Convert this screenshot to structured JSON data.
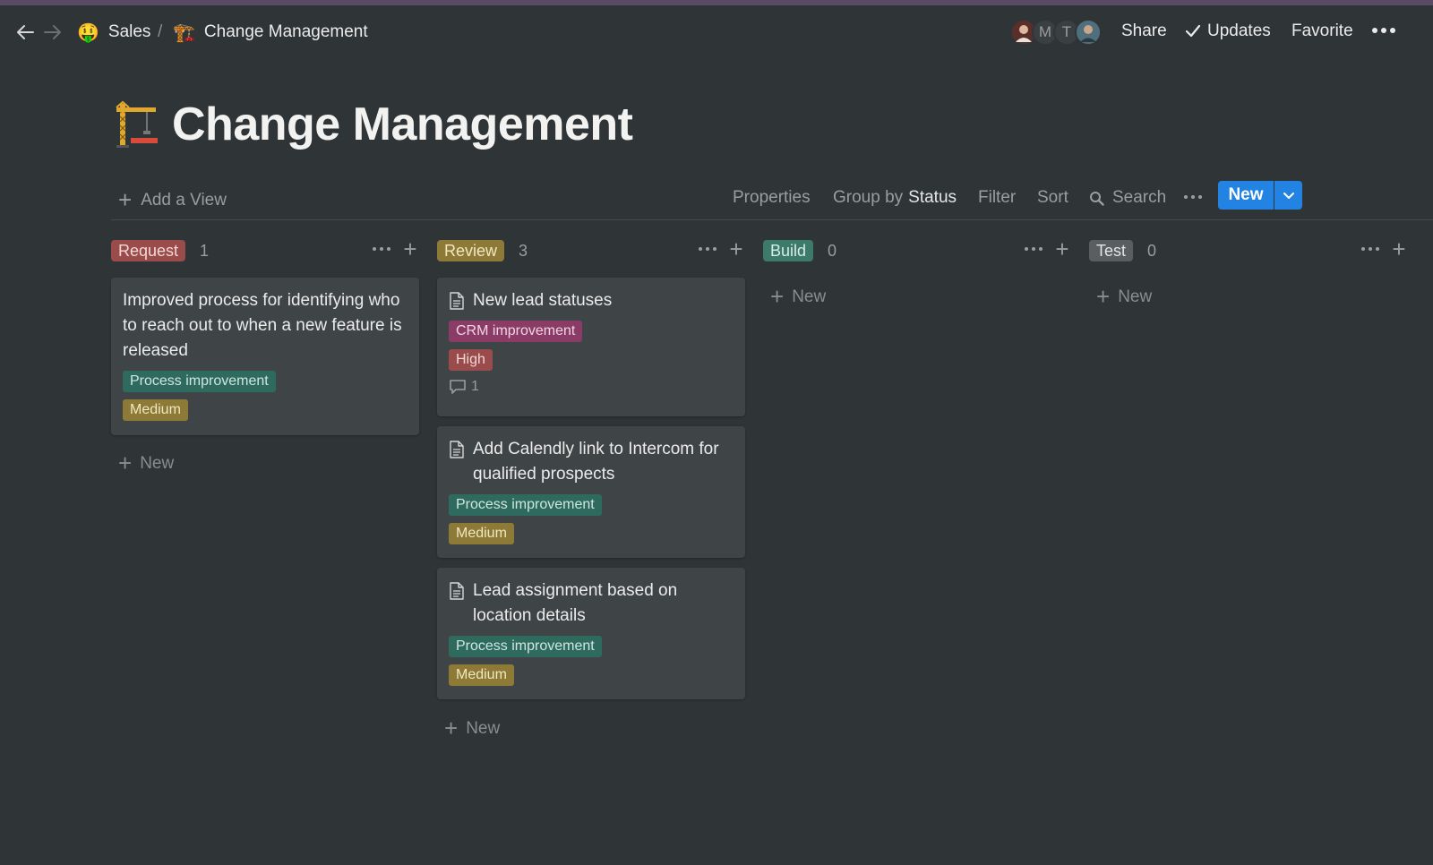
{
  "breadcrumb": {
    "workspace_emoji": "🤑",
    "workspace": "Sales",
    "separator": "/",
    "page_emoji": "🏗️",
    "page": "Change Management"
  },
  "topbar": {
    "avatars": [
      "photo",
      "M",
      "T",
      "photo"
    ],
    "share": "Share",
    "updates": "Updates",
    "favorite": "Favorite"
  },
  "page": {
    "icon": "construction-crane-icon",
    "title": "Change Management"
  },
  "toolbar": {
    "add_view": "Add a View",
    "properties": "Properties",
    "group_by_prefix": "Group by",
    "group_by_value": "Status",
    "filter": "Filter",
    "sort": "Sort",
    "search": "Search",
    "new": "New"
  },
  "colors": {
    "background": "#2f3437",
    "card": "#3f4447",
    "accent_blue": "#2383e2",
    "status_request": "#9a4b4b",
    "status_review": "#8c7a36",
    "status_build": "#3d7a6a",
    "status_test": "#5a5e60",
    "tag_process": "#2e6b5e",
    "tag_crm": "#8a3c66",
    "tag_medium": "#8c7a36",
    "tag_high": "#9a4b4b"
  },
  "board": {
    "new_label": "New",
    "columns": [
      {
        "status": "Request",
        "count": "1",
        "cards": [
          {
            "title": "Improved process for identifying who to reach out to when a new feature is released",
            "tags": [
              "Process improvement",
              "Medium"
            ]
          }
        ]
      },
      {
        "status": "Review",
        "count": "3",
        "cards": [
          {
            "title": "New lead statuses",
            "tags": [
              "CRM improvement",
              "High"
            ],
            "comments": "1"
          },
          {
            "title": "Add Calendly link to Intercom for qualified prospects",
            "tags": [
              "Process improvement",
              "Medium"
            ]
          },
          {
            "title": "Lead assignment based on location details",
            "tags": [
              "Process improvement",
              "Medium"
            ]
          }
        ]
      },
      {
        "status": "Build",
        "count": "0",
        "cards": []
      },
      {
        "status": "Test",
        "count": "0",
        "cards": []
      }
    ]
  }
}
